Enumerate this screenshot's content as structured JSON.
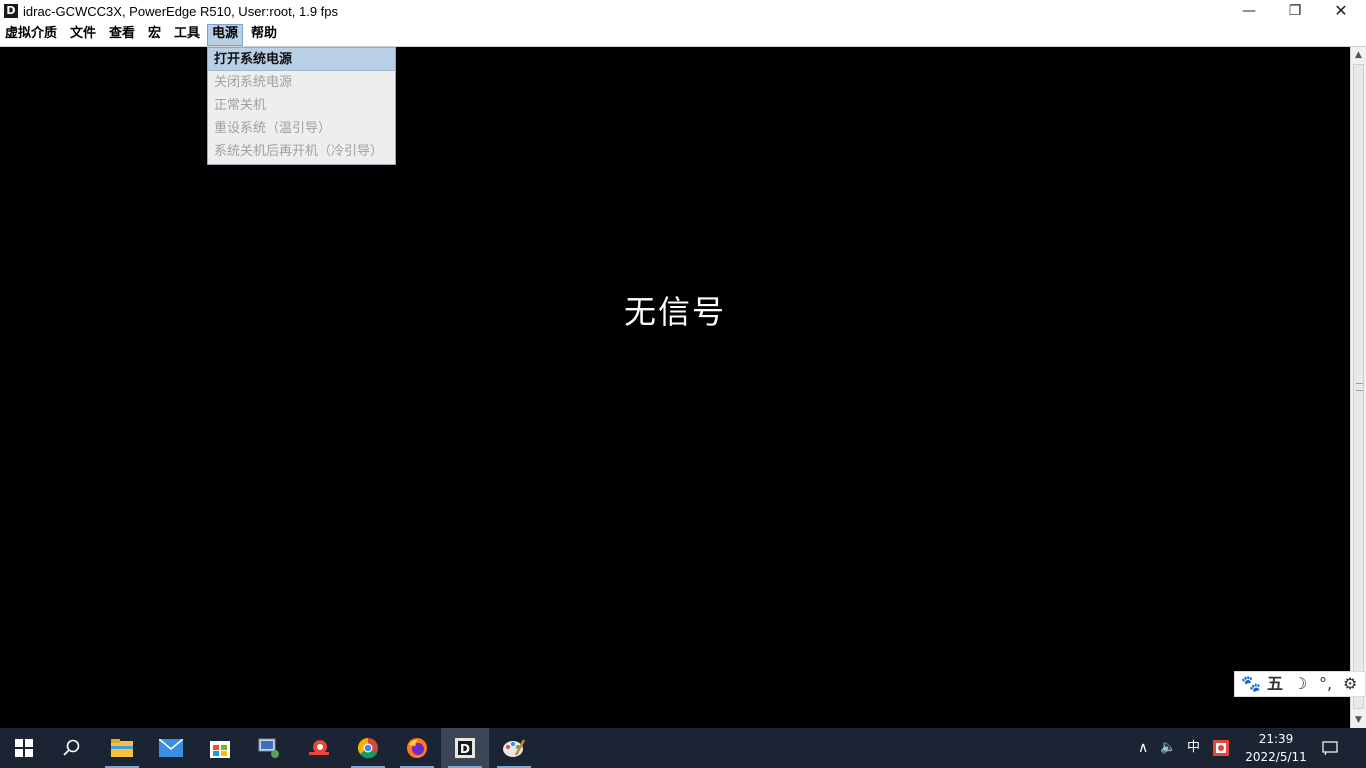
{
  "window": {
    "title": "idrac-GCWCC3X, PowerEdge R510, User:root, 1.9 fps",
    "app_icon_letter": "D",
    "minimize_glyph": "—",
    "maximize_glyph": "❐",
    "close_glyph": "✕"
  },
  "menubar": {
    "items": [
      "虚拟介质",
      "文件",
      "查看",
      "宏",
      "工具",
      "电源",
      "帮助"
    ],
    "active": "电源"
  },
  "power_menu": {
    "items": [
      {
        "label": "打开系统电源",
        "enabled": true
      },
      {
        "label": "关闭系统电源",
        "enabled": false
      },
      {
        "label": "正常关机",
        "enabled": false
      },
      {
        "label": "重设系统（温引导）",
        "enabled": false
      },
      {
        "label": "系统关机后再开机（冷引导）",
        "enabled": false
      }
    ]
  },
  "console": {
    "message": "无信号"
  },
  "ime_toolbar": {
    "icons": [
      "paw-icon",
      "wubi-icon",
      "moon-icon",
      "punctuation-icon",
      "gear-icon"
    ],
    "wubi_label": "五"
  },
  "taskbar": {
    "apps": [
      "start-icon",
      "search-icon",
      "file-explorer-icon",
      "mail-icon",
      "store-icon",
      "network-tool-icon",
      "snail-icon",
      "chrome-icon",
      "firefox-icon",
      "idrac-viewer-icon",
      "paint-icon"
    ],
    "tray": {
      "ime_mode": "中",
      "time": "21:39",
      "date": "2022/5/11"
    }
  }
}
